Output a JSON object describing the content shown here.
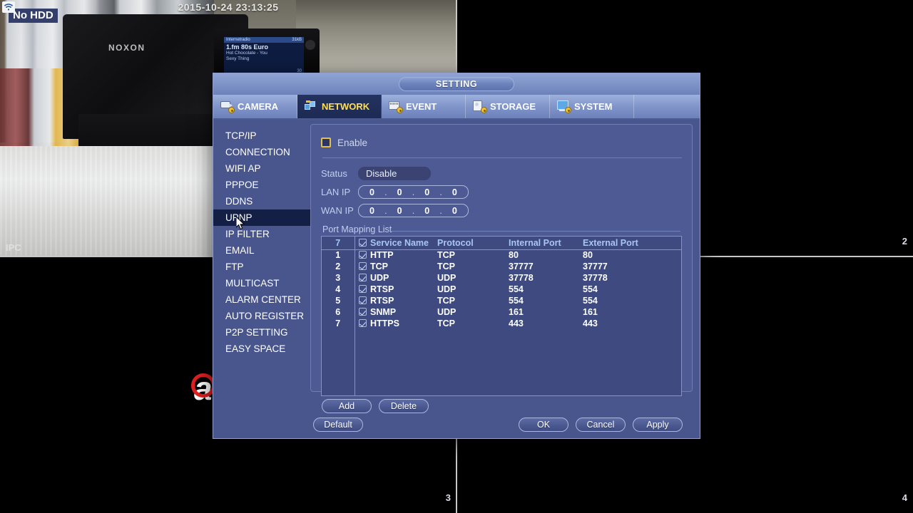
{
  "video": {
    "timestamp": "2015-10-24 23:13:25",
    "no_hdd_badge": "No HDD",
    "wifi_icon": "wifi-icon",
    "camera_label": "IPC",
    "device_brand": "NOXON",
    "channel_numbers": [
      "2",
      "3",
      "4"
    ],
    "watermark": "a",
    "watermark_right": "a",
    "radio": {
      "header": "Internetradio",
      "header_right": "31kB",
      "title": "1.fm 80s Euro",
      "line1": "Hot Chocolate - You",
      "line2": "Sexy Thing",
      "bitrate": "30"
    }
  },
  "dialog": {
    "title": "SETTING",
    "tabs": [
      {
        "label": "CAMERA",
        "icon": "camera-icon",
        "active": false
      },
      {
        "label": "NETWORK",
        "icon": "network-icon",
        "active": true
      },
      {
        "label": "EVENT",
        "icon": "event-icon",
        "active": false
      },
      {
        "label": "STORAGE",
        "icon": "storage-icon",
        "active": false
      },
      {
        "label": "SYSTEM",
        "icon": "system-icon",
        "active": false
      }
    ],
    "sidebar": [
      {
        "label": "TCP/IP",
        "active": false
      },
      {
        "label": "CONNECTION",
        "active": false
      },
      {
        "label": "WIFI AP",
        "active": false
      },
      {
        "label": "PPPOE",
        "active": false
      },
      {
        "label": "DDNS",
        "active": false
      },
      {
        "label": "UPNP",
        "active": true
      },
      {
        "label": "IP FILTER",
        "active": false
      },
      {
        "label": "EMAIL",
        "active": false
      },
      {
        "label": "FTP",
        "active": false
      },
      {
        "label": "MULTICAST",
        "active": false
      },
      {
        "label": "ALARM CENTER",
        "active": false
      },
      {
        "label": "AUTO REGISTER",
        "active": false
      },
      {
        "label": "P2P SETTING",
        "active": false
      },
      {
        "label": "EASY SPACE",
        "active": false
      }
    ],
    "panel": {
      "enable_label": "Enable",
      "enable_checked": false,
      "status_label": "Status",
      "status_value": "Disable",
      "lan_ip_label": "LAN IP",
      "lan_ip": [
        "0",
        "0",
        "0",
        "0"
      ],
      "wan_ip_label": "WAN IP",
      "wan_ip": [
        "0",
        "0",
        "0",
        "0"
      ],
      "port_mapping_title": "Port Mapping List",
      "table": {
        "count": "7",
        "headers": [
          "Service Name",
          "Protocol",
          "Internal Port",
          "External Port"
        ],
        "rows": [
          {
            "idx": "1",
            "checked": true,
            "service": "HTTP",
            "protocol": "TCP",
            "internal": "80",
            "external": "80"
          },
          {
            "idx": "2",
            "checked": true,
            "service": "TCP",
            "protocol": "TCP",
            "internal": "37777",
            "external": "37777"
          },
          {
            "idx": "3",
            "checked": true,
            "service": "UDP",
            "protocol": "UDP",
            "internal": "37778",
            "external": "37778"
          },
          {
            "idx": "4",
            "checked": true,
            "service": "RTSP",
            "protocol": "UDP",
            "internal": "554",
            "external": "554"
          },
          {
            "idx": "5",
            "checked": true,
            "service": "RTSP",
            "protocol": "TCP",
            "internal": "554",
            "external": "554"
          },
          {
            "idx": "6",
            "checked": true,
            "service": "SNMP",
            "protocol": "UDP",
            "internal": "161",
            "external": "161"
          },
          {
            "idx": "7",
            "checked": true,
            "service": "HTTPS",
            "protocol": "TCP",
            "internal": "443",
            "external": "443"
          }
        ]
      },
      "buttons": {
        "add": "Add",
        "delete": "Delete",
        "default": "Default",
        "ok": "OK",
        "cancel": "Cancel",
        "apply": "Apply"
      }
    }
  },
  "colors": {
    "dialog_bg": "#49568e",
    "panel_bg": "#4d5a93",
    "active_tab_text": "#ffe04d",
    "active_item_bg": "#141f45",
    "checkbox_border": "#e2c14a",
    "header_text": "#a9c6f2",
    "label_text": "#bfd0ee"
  }
}
